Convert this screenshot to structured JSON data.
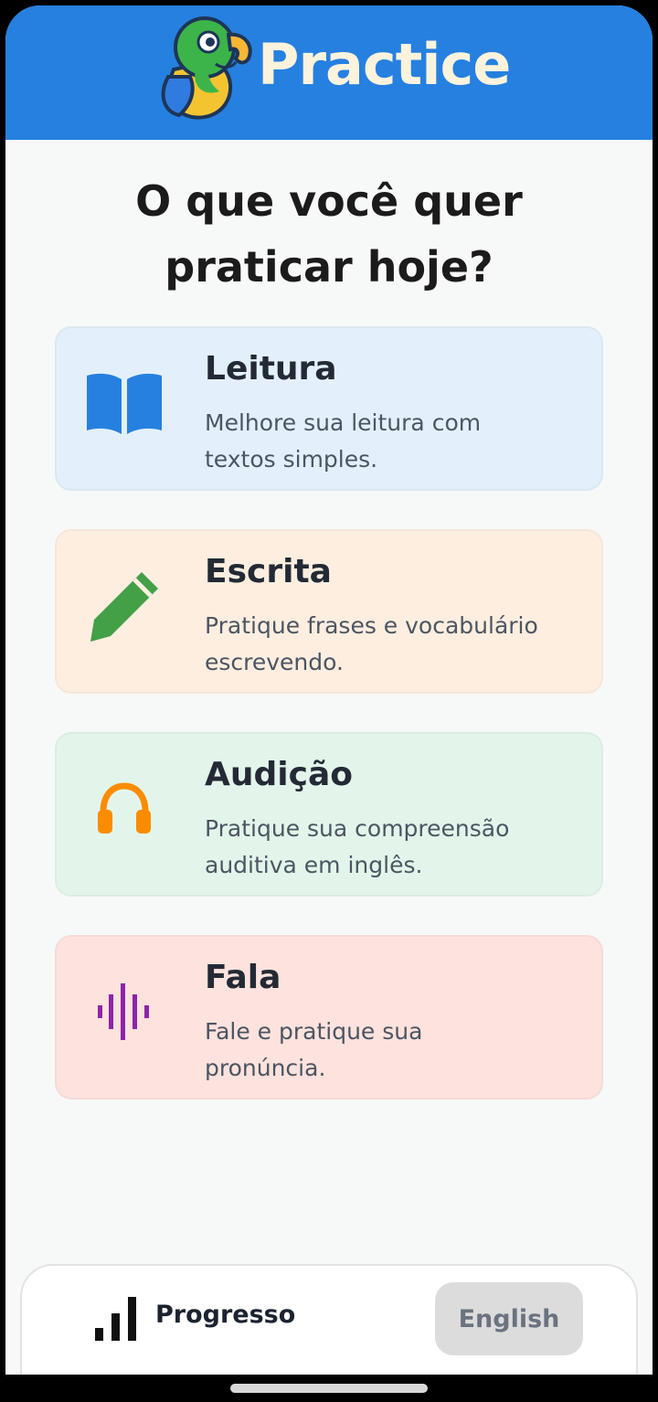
{
  "header": {
    "app_title": "Practice",
    "logo_icon": "parrot-logo"
  },
  "question": {
    "line1": "O que você quer",
    "line2": "praticar hoje?"
  },
  "cards": [
    {
      "title": "Leitura",
      "desc_line1": "Melhore sua leitura com",
      "desc_line2": "textos simples.",
      "icon": "book-icon",
      "color": "#2680e0",
      "bg": "#e3f0fb"
    },
    {
      "title": "Escrita",
      "desc_line1": "Pratique frases e vocabulário",
      "desc_line2": "escrevendo.",
      "icon": "pencil-icon",
      "color": "#43a047",
      "bg": "#fdeee0"
    },
    {
      "title": "Audição",
      "desc_line1": "Pratique sua compreensão",
      "desc_line2": "auditiva em inglês.",
      "icon": "headphones-icon",
      "color": "#fb8c00",
      "bg": "#e3f5ea"
    },
    {
      "title": "Fala",
      "desc_line1": "Fale e pratique sua",
      "desc_line2": "pronúncia.",
      "icon": "soundwave-icon",
      "color": "#8e24aa",
      "bg": "#fde2dd"
    }
  ],
  "bottom_bar": {
    "progress_label": "Progresso",
    "progress_icon": "bar-chart-icon",
    "language_button": "English"
  }
}
